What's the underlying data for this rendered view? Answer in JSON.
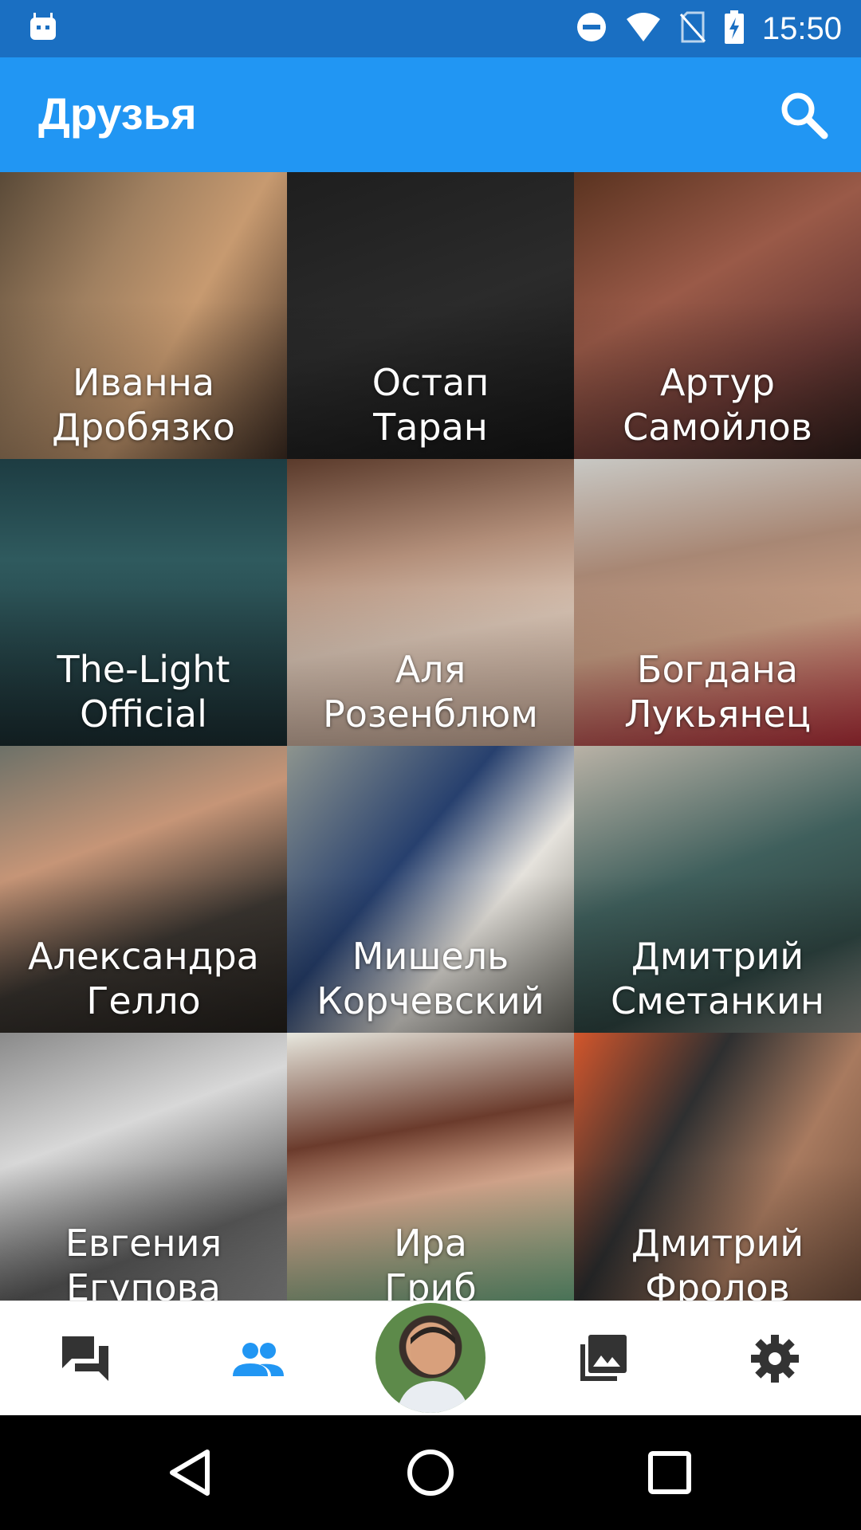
{
  "status_bar": {
    "time": "15:50",
    "icons": [
      "android-icon",
      "do-not-disturb-icon",
      "wifi-icon",
      "no-sim-icon",
      "battery-charging-icon"
    ]
  },
  "app_bar": {
    "title": "Друзья",
    "search_icon": "search-icon"
  },
  "friends": [
    {
      "first": "Иванна",
      "last": "Дробязко"
    },
    {
      "first": "Остап",
      "last": "Таран"
    },
    {
      "first": "Артур",
      "last": "Самойлов"
    },
    {
      "first": "The-Light",
      "last": "Official"
    },
    {
      "first": "Аля",
      "last": "Розенблюм"
    },
    {
      "first": "Богдана",
      "last": "Лукьянец"
    },
    {
      "first": "Александра",
      "last": "Гелло"
    },
    {
      "first": "Мишель",
      "last": "Корчевский"
    },
    {
      "first": "Дмитрий",
      "last": "Сметанкин"
    },
    {
      "first": "Евгения",
      "last": "Егупова"
    },
    {
      "first": "Ира",
      "last": "Гриб"
    },
    {
      "first": "Дмитрий",
      "last": "Фролов"
    }
  ],
  "bottom_nav": {
    "items": [
      {
        "icon": "messages-icon",
        "active": false
      },
      {
        "icon": "friends-icon",
        "active": true
      },
      {
        "icon": "profile-avatar",
        "active": false
      },
      {
        "icon": "photos-icon",
        "active": false
      },
      {
        "icon": "settings-icon",
        "active": false
      }
    ],
    "active_color": "#2196f3",
    "inactive_color": "#333333"
  },
  "colors": {
    "status_bar": "#1a6fc2",
    "app_bar": "#2196f3"
  }
}
